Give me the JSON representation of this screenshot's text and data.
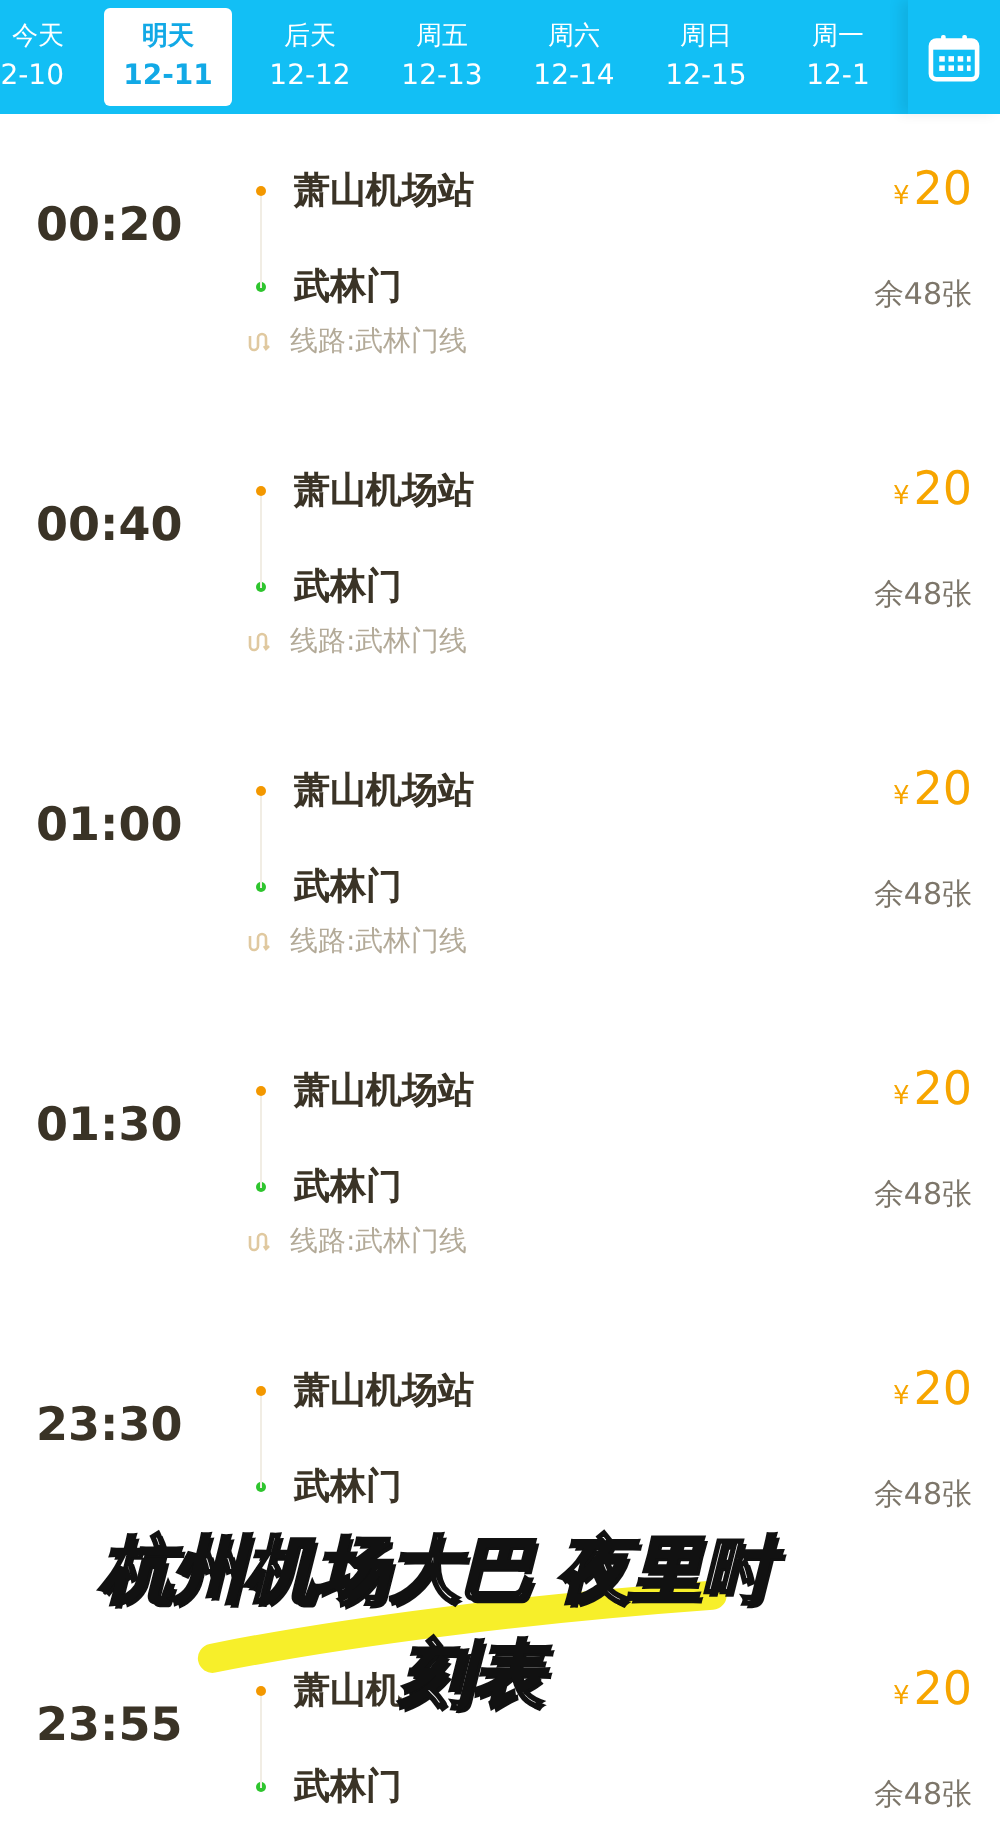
{
  "date_tabs": [
    {
      "day": "今天",
      "date": "2-10",
      "selected": false
    },
    {
      "day": "明天",
      "date": "12-11",
      "selected": true
    },
    {
      "day": "后天",
      "date": "12-12",
      "selected": false
    },
    {
      "day": "周五",
      "date": "12-13",
      "selected": false
    },
    {
      "day": "周六",
      "date": "12-14",
      "selected": false
    },
    {
      "day": "周日",
      "date": "12-15",
      "selected": false
    },
    {
      "day": "周一",
      "date": "12-1",
      "selected": false
    }
  ],
  "schedules": [
    {
      "time": "00:20",
      "from": "萧山机场站",
      "to": "武林门",
      "currency": "¥",
      "price": "20",
      "remaining": "余48张",
      "route": "线路:武林门线"
    },
    {
      "time": "00:40",
      "from": "萧山机场站",
      "to": "武林门",
      "currency": "¥",
      "price": "20",
      "remaining": "余48张",
      "route": "线路:武林门线"
    },
    {
      "time": "01:00",
      "from": "萧山机场站",
      "to": "武林门",
      "currency": "¥",
      "price": "20",
      "remaining": "余48张",
      "route": "线路:武林门线"
    },
    {
      "time": "01:30",
      "from": "萧山机场站",
      "to": "武林门",
      "currency": "¥",
      "price": "20",
      "remaining": "余48张",
      "route": "线路:武林门线"
    },
    {
      "time": "23:30",
      "from": "萧山机场站",
      "to": "武林门",
      "currency": "¥",
      "price": "20",
      "remaining": "余48张"
    },
    {
      "time": "23:55",
      "from": "萧山机",
      "to": "武林门",
      "currency": "¥",
      "price": "20",
      "remaining": "余48张"
    }
  ],
  "caption": {
    "line_1": "杭州机场大巴 夜里时",
    "line_2": "刻表"
  }
}
